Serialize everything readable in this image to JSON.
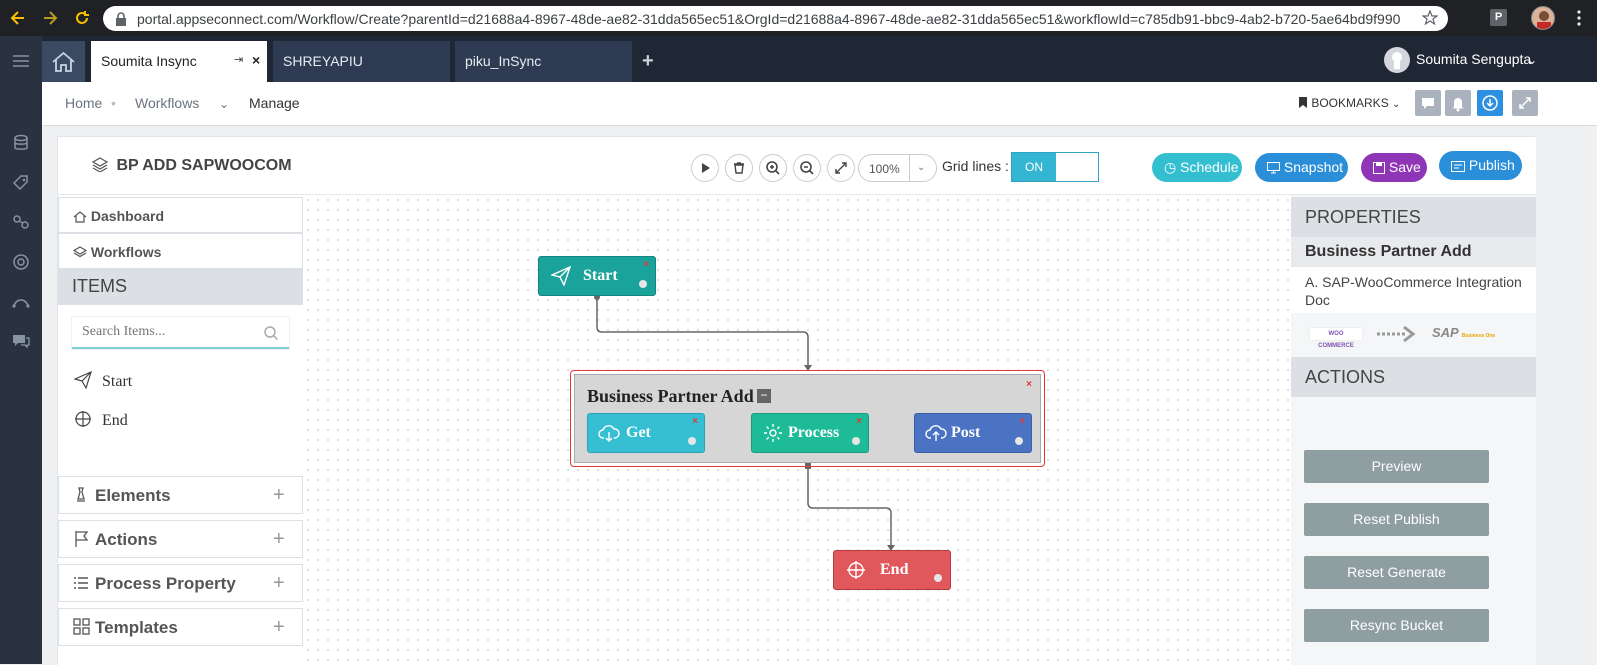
{
  "browser": {
    "url": "portal.appseconnect.com/Workflow/Create?parentId=d21688a4-8967-48de-ae82-31dda565ec51&OrgId=d21688a4-8967-48de-ae82-31dda565ec51&workflowId=c785db91-bbc9-4ab2-b720-5ae64bd9f990",
    "extension_label": "P"
  },
  "tabs": [
    {
      "label": "Soumita Insync",
      "active": true
    },
    {
      "label": "SHREYAPIU",
      "active": false
    },
    {
      "label": "piku_InSync",
      "active": false
    }
  ],
  "add_tab_label": "+",
  "user": {
    "name": "Soumita Sengupta"
  },
  "breadcrumb": {
    "home": "Home",
    "workflows": "Workflows",
    "manage": "Manage"
  },
  "bookmarks_label": "BOOKMARKS",
  "workflow": {
    "title": "BP ADD SAPWOOCOM",
    "zoom": "100%",
    "grid_label": "Grid lines :",
    "grid_state": "ON",
    "buttons": {
      "schedule": "Schedule",
      "snapshot": "Snapshot",
      "save": "Save",
      "publish": "Publish"
    }
  },
  "left_panel": {
    "dashboard": "Dashboard",
    "workflows": "Workflows",
    "items_header": "ITEMS",
    "search_placeholder": "Search Items...",
    "items": [
      "Start",
      "End"
    ],
    "accordions": [
      "Elements",
      "Actions",
      "Process Property",
      "Templates"
    ],
    "plus": "+"
  },
  "canvas": {
    "start": "Start",
    "group_title": "Business Partner Add",
    "group_collapse": "−",
    "steps": [
      "Get",
      "Process",
      "Post"
    ],
    "end": "End",
    "delete_mark": "×"
  },
  "right_panel": {
    "properties_header": "PROPERTIES",
    "name": "Business Partner Add",
    "description": "A. SAP-WooCommerce Integration Doc",
    "logo_left": "WOO COMMERCE",
    "logo_right": "SAP",
    "logo_right_sub": "Business One",
    "actions_header": "ACTIONS",
    "action_buttons": [
      "Preview",
      "Reset Publish",
      "Reset Generate",
      "Resync Bucket"
    ]
  },
  "colors": {
    "start": "#1aa39a",
    "get": "#36bfd3",
    "process": "#1dbb98",
    "post": "#4a73c4",
    "end": "#e0585c",
    "schedule": "#34bfd1",
    "snapshot": "#2a8fd8",
    "save": "#8e36b5",
    "publish": "#2a8fd8",
    "action_button": "#8e9ea1"
  },
  "icons": [
    "back-icon",
    "forward-icon",
    "reload-icon",
    "lock-icon",
    "star-icon",
    "home-icon",
    "pin-icon",
    "close-icon",
    "chat-icon",
    "bell-icon",
    "download-icon",
    "expand-icon",
    "play-icon",
    "trash-icon",
    "zoom-in-icon",
    "zoom-out-icon",
    "fit-icon",
    "send-icon",
    "crosshair-icon",
    "cloud-download-icon",
    "gear-icon",
    "cloud-upload-icon"
  ]
}
